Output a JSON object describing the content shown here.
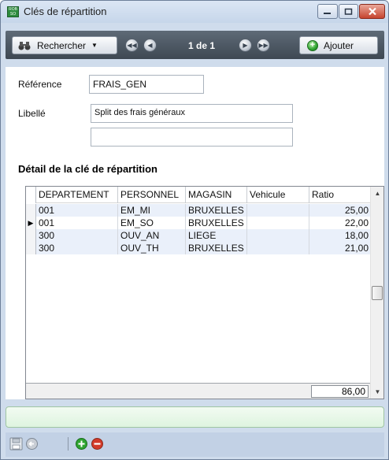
{
  "window": {
    "title": "Clés de répartition",
    "icon_text": "ROB SO"
  },
  "toolbar": {
    "search_label": "Rechercher",
    "page_info": "1 de 1",
    "add_label": "Ajouter"
  },
  "form": {
    "reference_label": "Référence",
    "reference_value": "FRAIS_GEN",
    "libelle_label": "Libellé",
    "libelle_value": "Split des frais généraux",
    "libelle2_value": ""
  },
  "section": {
    "title": "Détail de la clé de répartition"
  },
  "grid": {
    "columns": [
      "DEPARTEMENT",
      "PERSONNEL",
      "MAGASIN",
      "Vehicule",
      "Ratio"
    ],
    "rows": [
      {
        "departement": "001",
        "personnel": "EM_MI",
        "magasin": "BRUXELLES",
        "vehicule": "",
        "ratio": "25,00",
        "current": false
      },
      {
        "departement": "001",
        "personnel": "EM_SO",
        "magasin": "BRUXELLES",
        "vehicule": "",
        "ratio": "22,00",
        "current": true
      },
      {
        "departement": "300",
        "personnel": "OUV_AN",
        "magasin": "LIEGE",
        "vehicule": "",
        "ratio": "18,00",
        "current": false
      },
      {
        "departement": "300",
        "personnel": "OUV_TH",
        "magasin": "BRUXELLES",
        "vehicule": "",
        "ratio": "21,00",
        "current": false
      }
    ],
    "total": "86,00"
  },
  "status": {
    "message": ""
  },
  "colors": {
    "toolbar_bg": "#4e5966",
    "row_alt": "#eaf0fa",
    "status_bg": "#e8f7e8",
    "accent_green": "#2fa431",
    "accent_red": "#d23a2a"
  }
}
